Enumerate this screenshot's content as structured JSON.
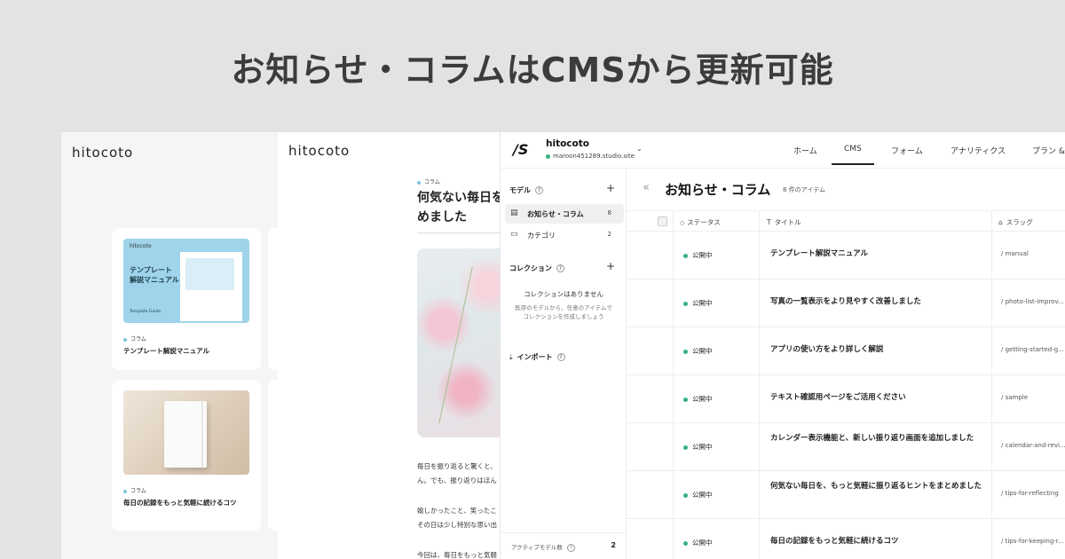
{
  "headline": "お知らせ・コラムはCMSから更新可能",
  "back_site": {
    "logo": "hitocoto",
    "cards": [
      {
        "thumb_logo": "hitocoto",
        "thumb_title_line1": "テンプレート",
        "thumb_title_line2": "解説マニュアル",
        "thumb_subtitle": "Template Guide",
        "category": "コラム",
        "title": "テンプレート解説マニュアル"
      },
      {
        "category": "コラム",
        "title": "毎日の記録をもっと気軽に続けるコツ"
      }
    ]
  },
  "article_site": {
    "logo": "hitocoto",
    "category": "コラム",
    "title_line1": "何気ない毎日を",
    "title_line2": "めました",
    "body": [
      "毎日を振り返ると驚くと、",
      "ん。でも、振り返りはほん",
      "嬉しかったこと、笑ったこ",
      "その日は少し特別な思い出",
      "今回は、毎日をもっと気軽"
    ]
  },
  "cms": {
    "site_name": "hitocoto",
    "site_url": "maroon451289.studio.site",
    "nav": [
      "ホーム",
      "CMS",
      "フォーム",
      "アナリティクス",
      "プラン &"
    ],
    "nav_active": "CMS",
    "sidebar": {
      "models_label": "モデル",
      "models": [
        {
          "label": "お知らせ・コラム",
          "count": "8"
        },
        {
          "label": "カテゴリ",
          "count": "2"
        }
      ],
      "collections_label": "コレクション",
      "collections_empty": "コレクションはありません",
      "collections_hint_line1": "既存のモデルから、任意のアイテムで",
      "collections_hint_line2": "コレクションを作成しましょう",
      "import_label": "インポート",
      "active_models_label": "アクティブモデル数",
      "active_models_count": "2"
    },
    "main": {
      "title": "お知らせ・コラム",
      "item_count": "8 件のアイテム",
      "columns": {
        "status": "ステータス",
        "title": "タイトル",
        "slug": "スラッグ"
      },
      "rows": [
        {
          "status": "公開中",
          "title": "テンプレート解説マニュアル",
          "slug": "/ manual"
        },
        {
          "status": "公開中",
          "title": "写真の一覧表示をより見やすく改善しました",
          "slug": "/ photo-list-improv..."
        },
        {
          "status": "公開中",
          "title": "アプリの使い方をより詳しく解説",
          "slug": "/ getting-started-g..."
        },
        {
          "status": "公開中",
          "title": "テキスト確認用ページをご活用ください",
          "slug": "/ sample"
        },
        {
          "status": "公開中",
          "title": "カレンダー表示機能と、新しい振り返り画面を追加しました",
          "slug": "/ calendar-and-revi..."
        },
        {
          "status": "公開中",
          "title": "何気ない毎日を、もっと気軽に振り返るヒントをまとめました",
          "slug": "/ tips-for-reflecting"
        },
        {
          "status": "公開中",
          "title": "毎日の記録をもっと気軽に続けるコツ",
          "slug": "/ tips-for-keeping-r..."
        }
      ]
    }
  }
}
